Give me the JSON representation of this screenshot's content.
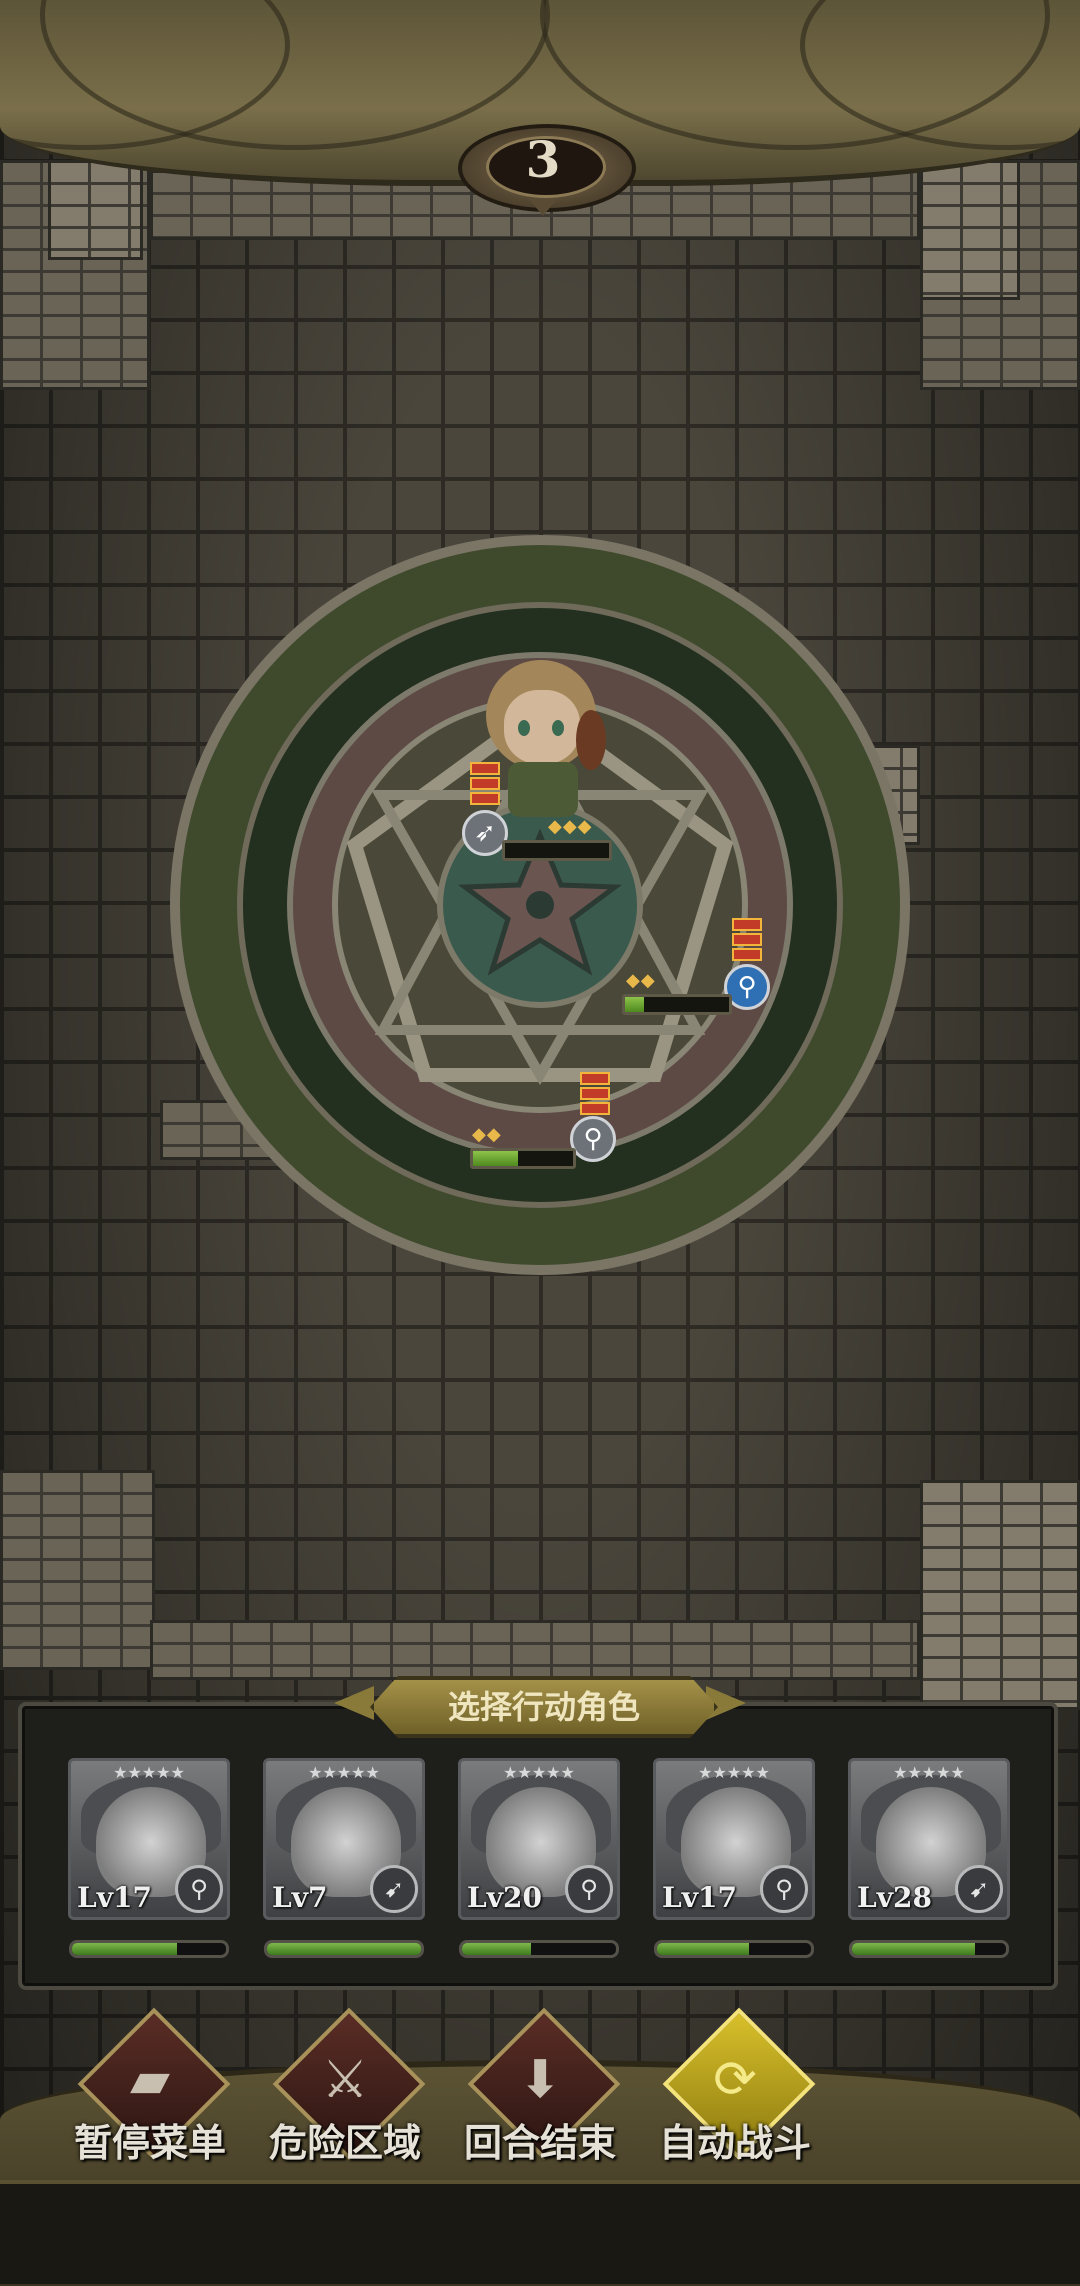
{
  "turn": {
    "number": "3"
  },
  "battlefield": {
    "units": [
      {
        "role": "archer",
        "role_icon": "bow-icon",
        "hp": 0.0
      },
      {
        "role": "staff",
        "role_icon": "staff-icon",
        "hp": 0.18
      },
      {
        "role": "staff",
        "role_icon": "staff-icon",
        "hp": 0.45
      }
    ]
  },
  "panel": {
    "title": "选择行动角色",
    "characters": [
      {
        "level": "Lv17",
        "stars": "★★★★★",
        "weapon_icon": "staff-icon",
        "hp": 0.68
      },
      {
        "level": "Lv7",
        "stars": "★★★★★",
        "weapon_icon": "spear-icon",
        "hp": 1.0
      },
      {
        "level": "Lv20",
        "stars": "★★★★★",
        "weapon_icon": "staff-icon",
        "hp": 0.45
      },
      {
        "level": "Lv17",
        "stars": "★★★★★",
        "weapon_icon": "staff-icon",
        "hp": 0.6
      },
      {
        "level": "Lv28",
        "stars": "★★★★★",
        "weapon_icon": "spear-icon",
        "hp": 0.8
      }
    ]
  },
  "menu": {
    "pause": {
      "label": "暂停菜单",
      "icon": "book-icon"
    },
    "danger": {
      "label": "危险区域",
      "icon": "crossed-swords-icon"
    },
    "end_turn": {
      "label": "回合结束",
      "icon": "download-arrow-icon"
    },
    "auto": {
      "label": "自动战斗",
      "icon": "cycle-arrows-icon"
    }
  },
  "colors": {
    "hp_green": "#6fae3b",
    "accent_gold": "#d8c02a",
    "role_blue": "#2f6fb3"
  }
}
